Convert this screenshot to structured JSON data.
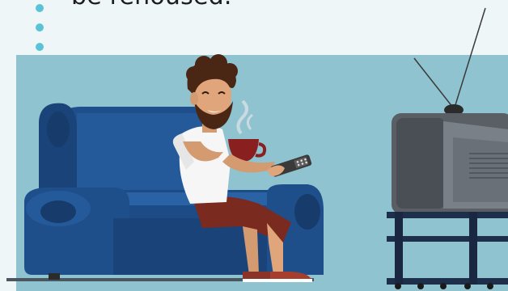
{
  "bullet": {
    "text": "be rehoused."
  },
  "colors": {
    "bullet_dot": "#5bc3d6",
    "panel_bg": "#8fc3cf",
    "sofa_blue": "#1f4f8a",
    "tv_grey": "#5a5f66"
  },
  "icons": {
    "bullets": [
      "bullet-dot",
      "bullet-dot",
      "bullet-dot"
    ],
    "illustration": "man-watching-tv-illustration"
  }
}
